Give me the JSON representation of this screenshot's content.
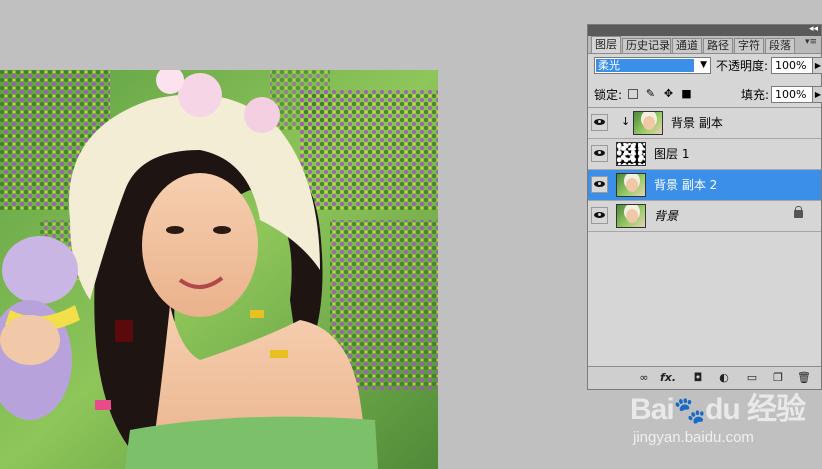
{
  "panel": {
    "collapse_icon": "double-chevron-icon",
    "tabs": [
      {
        "label": "图层",
        "active": true
      },
      {
        "label": "历史记录",
        "active": false
      },
      {
        "label": "通道",
        "active": false
      },
      {
        "label": "路径",
        "active": false
      },
      {
        "label": "字符",
        "active": false
      },
      {
        "label": "段落",
        "active": false
      }
    ],
    "menu_icon": "panel-menu-icon",
    "blend_mode": "柔光",
    "opacity_label": "不透明度:",
    "opacity_value": "100%",
    "lock_label": "锁定:",
    "fill_label": "填充:",
    "fill_value": "100%",
    "layers": [
      {
        "name": "背景 副本",
        "visible": true,
        "clipped": true,
        "thumb": "photo",
        "selected": false
      },
      {
        "name": "图层 1",
        "visible": true,
        "clipped": false,
        "thumb": "mask",
        "selected": false
      },
      {
        "name": "背景 副本 2",
        "visible": true,
        "clipped": false,
        "thumb": "photo",
        "selected": true
      },
      {
        "name": "背景",
        "visible": true,
        "clipped": false,
        "thumb": "photo",
        "selected": false,
        "locked": true
      }
    ],
    "bottom_icons": [
      "link-icon",
      "fx-icon",
      "layer-mask-icon",
      "adjustment-layer-icon",
      "new-group-icon",
      "new-layer-icon",
      "delete-icon"
    ],
    "fx_label": "fx."
  },
  "colors": {
    "selection": "#3b8fe8",
    "panel_bg": "#d6d6d6",
    "workspace_bg": "#c0c0c0"
  },
  "watermark": {
    "logo": "Bai du 经验",
    "url": "jingyan.baidu.com"
  }
}
